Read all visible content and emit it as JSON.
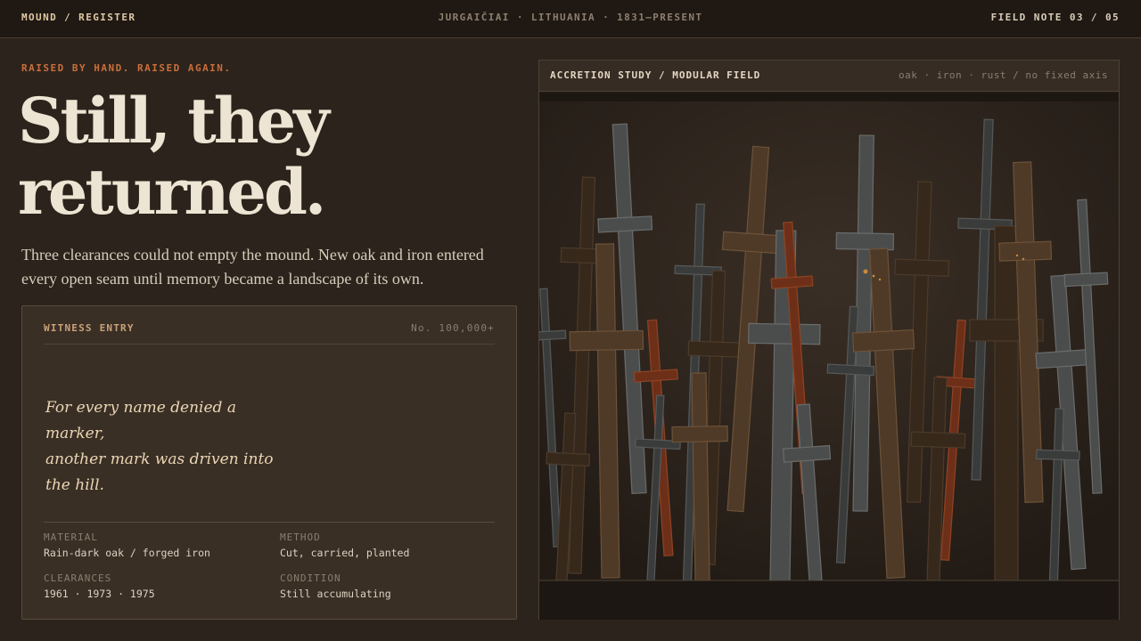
{
  "topbar": {
    "left": "MOUND / REGISTER",
    "center": "JURGAIČIAI · LITHUANIA · 1831—PRESENT",
    "right": "FIELD NOTE 03 / 05"
  },
  "hero": {
    "kicker": "RAISED BY HAND. RAISED AGAIN.",
    "headline_line1": "Still, they",
    "headline_line2": "returned.",
    "lede": "Three clearances could not empty the mound. New oak and iron entered every open seam until memory became a landscape of its own."
  },
  "witness": {
    "label": "WITNESS ENTRY",
    "number": "No. 100,000+",
    "quote_line1": "For every name denied a marker,",
    "quote_line2": "another mark was driven into",
    "quote_line3": "the hill.",
    "material_label": "MATERIAL",
    "material_value": "Rain-dark oak / forged iron",
    "method_label": "METHOD",
    "method_value": "Cut, carried, planted",
    "clearances_label": "CLEARANCES",
    "clearances_value": "1961 · 1973 · 1975",
    "condition_label": "CONDITION",
    "condition_value": "Still accumulating"
  },
  "study": {
    "title": "ACCRETION STUDY / MODULAR FIELD",
    "tags": "oak · iron · rust / no fixed axis"
  },
  "colors": {
    "background": "#2c231c",
    "accent": "#c96f3c",
    "oak": "#4f3a28",
    "iron": "#4b4d4d",
    "rust": "#6e2f19"
  }
}
